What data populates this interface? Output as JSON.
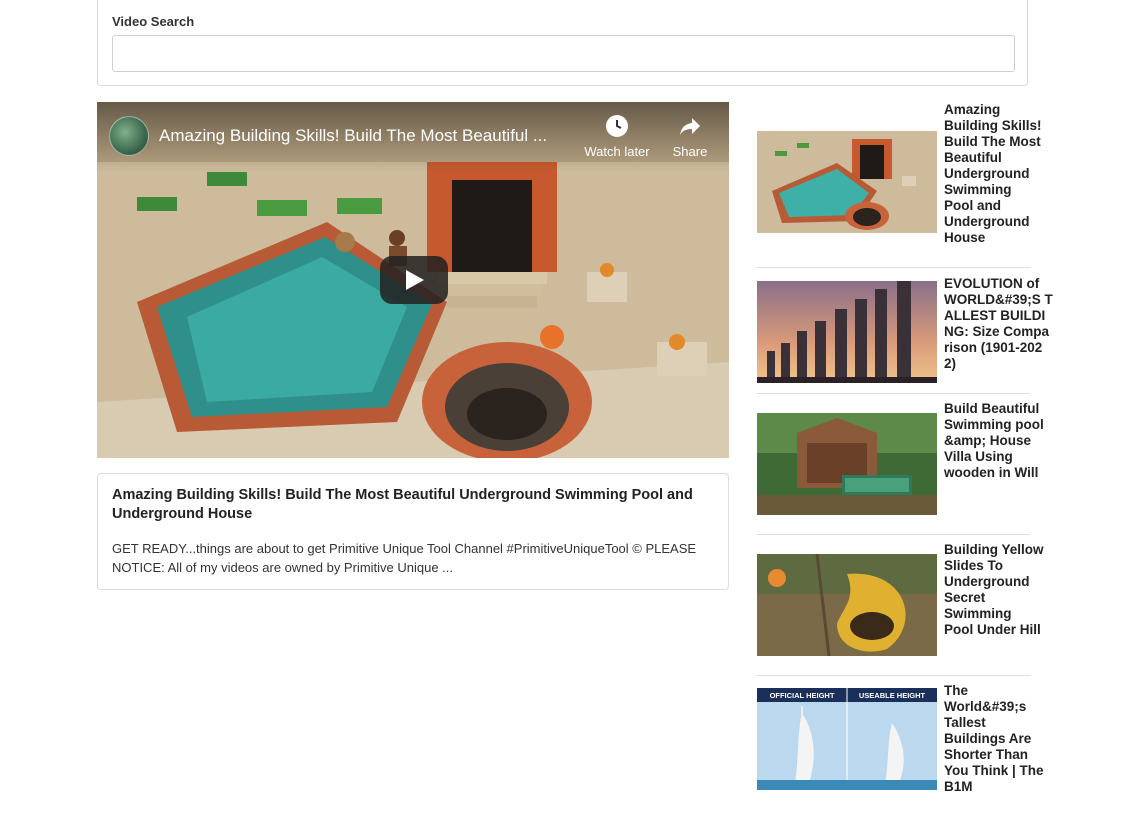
{
  "search": {
    "label": "Video Search",
    "value": "",
    "placeholder": ""
  },
  "player": {
    "title": "Amazing Building Skills! Build The Most Beautiful ...",
    "watch_later_label": "Watch later",
    "share_label": "Share"
  },
  "description": {
    "title": "Amazing Building Skills! Build The Most Beautiful Underground Swimming Pool and Underground House",
    "text": "GET READY...things are about to get Primitive Unique Tool Channel #PrimitiveUniqueTool © PLEASE NOTICE: All of my videos are owned by Primitive Unique ..."
  },
  "video_list": [
    {
      "title": "Amazing Building Skills! Build The Most Beautiful Underground Swimming Pool and Underground House"
    },
    {
      "title": "EVOLUTION of WORLD&#39;S TALLEST BUILDING: Size Comparison (1901-2022)"
    },
    {
      "title": "Build Beautiful Swimming pool &amp; House Villa Using wooden in Will"
    },
    {
      "title": "Building Yellow Slides To Underground Secret Swimming Pool Under Hill"
    },
    {
      "title": "The World&#39;s Tallest Buildings Are Shorter Than You Think | The B1M",
      "thumb_left_label": "OFFICIAL HEIGHT",
      "thumb_right_label": "USEABLE HEIGHT"
    }
  ]
}
